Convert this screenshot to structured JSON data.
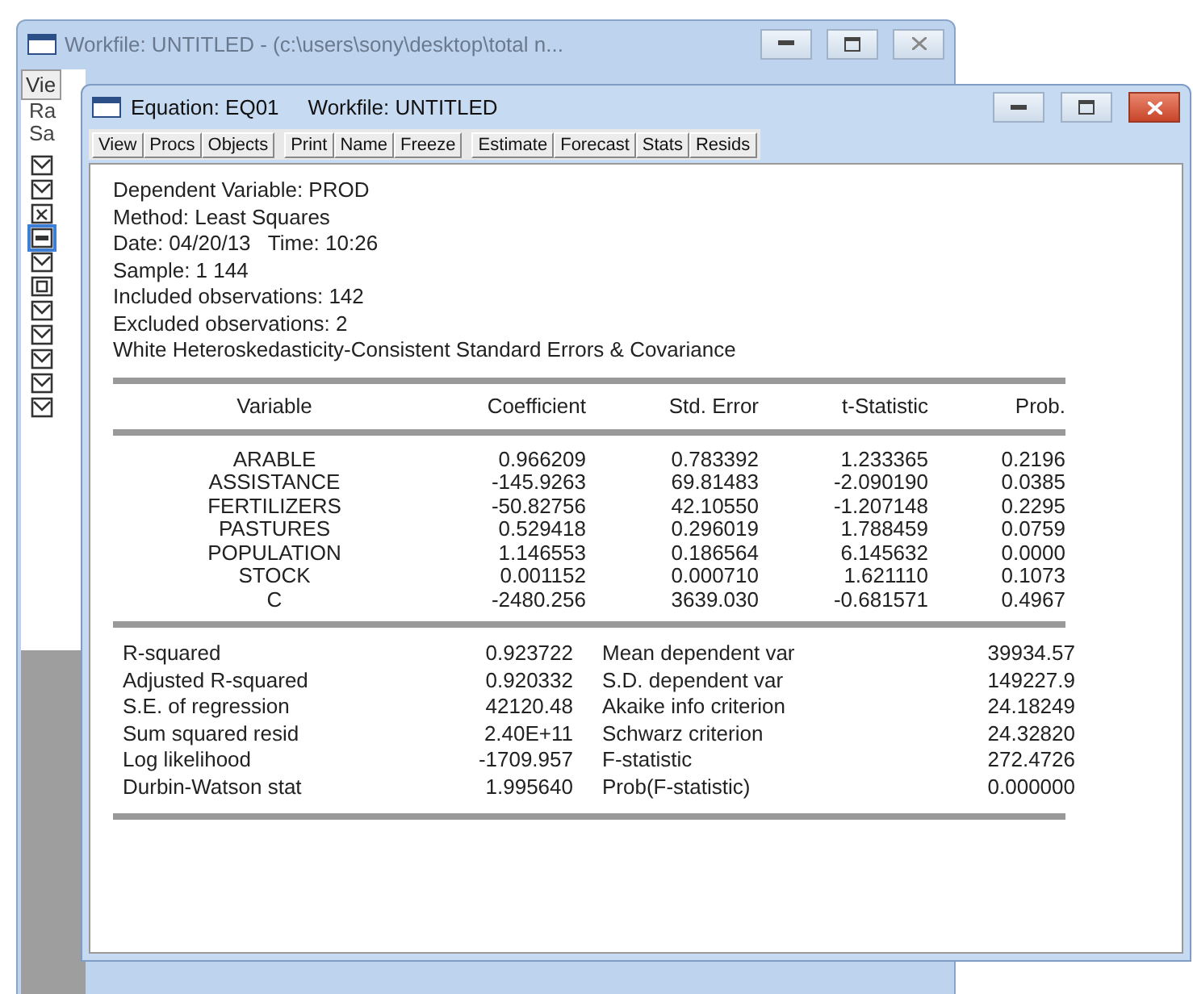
{
  "workfile": {
    "title": "Workfile: UNTITLED - (c:\\users\\sony\\desktop\\total n...",
    "menu": "Vie",
    "lines": [
      "Ra",
      "Sa"
    ],
    "objects": [
      {
        "kind": "series",
        "selected": false
      },
      {
        "kind": "series",
        "selected": false
      },
      {
        "kind": "coef",
        "selected": false
      },
      {
        "kind": "equation",
        "selected": true
      },
      {
        "kind": "series",
        "selected": false
      },
      {
        "kind": "group",
        "selected": false
      },
      {
        "kind": "series",
        "selected": false
      },
      {
        "kind": "series",
        "selected": false
      },
      {
        "kind": "series",
        "selected": false
      },
      {
        "kind": "series",
        "selected": false
      },
      {
        "kind": "series",
        "selected": false
      }
    ]
  },
  "equation": {
    "title": "Equation: EQ01",
    "workfile": "Workfile: UNTITLED",
    "toolbar": [
      [
        "View",
        "Procs",
        "Objects"
      ],
      [
        "Print",
        "Name",
        "Freeze"
      ],
      [
        "Estimate",
        "Forecast",
        "Stats",
        "Resids"
      ]
    ],
    "header": [
      "Dependent Variable: PROD",
      "Method: Least Squares",
      "Date: 04/20/13   Time: 10:26",
      "Sample: 1 144",
      "Included observations: 142",
      "Excluded observations: 2",
      "White Heteroskedasticity-Consistent Standard Errors & Covariance"
    ],
    "columns": [
      "Variable",
      "Coefficient",
      "Std. Error",
      "t-Statistic",
      "Prob."
    ],
    "rows": [
      [
        "ARABLE",
        "0.966209",
        "0.783392",
        "1.233365",
        "0.2196"
      ],
      [
        "ASSISTANCE",
        "-145.9263",
        "69.81483",
        "-2.090190",
        "0.0385"
      ],
      [
        "FERTILIZERS",
        "-50.82756",
        "42.10550",
        "-1.207148",
        "0.2295"
      ],
      [
        "PASTURES",
        "0.529418",
        "0.296019",
        "1.788459",
        "0.0759"
      ],
      [
        "POPULATION",
        "1.146553",
        "0.186564",
        "6.145632",
        "0.0000"
      ],
      [
        "STOCK",
        "0.001152",
        "0.000710",
        "1.621110",
        "0.1073"
      ],
      [
        "C",
        "-2480.256",
        "3639.030",
        "-0.681571",
        "0.4967"
      ]
    ],
    "stats": [
      [
        "R-squared",
        "0.923722",
        "Mean dependent var",
        "39934.57"
      ],
      [
        "Adjusted R-squared",
        "0.920332",
        "S.D. dependent var",
        "149227.9"
      ],
      [
        "S.E. of regression",
        "42120.48",
        "Akaike info criterion",
        "24.18249"
      ],
      [
        "Sum squared resid",
        "2.40E+11",
        "Schwarz criterion",
        "24.32820"
      ],
      [
        "Log likelihood",
        "-1709.957",
        "F-statistic",
        "272.4726"
      ],
      [
        "Durbin-Watson stat",
        "1.995640",
        "Prob(F-statistic)",
        "0.000000"
      ]
    ]
  }
}
